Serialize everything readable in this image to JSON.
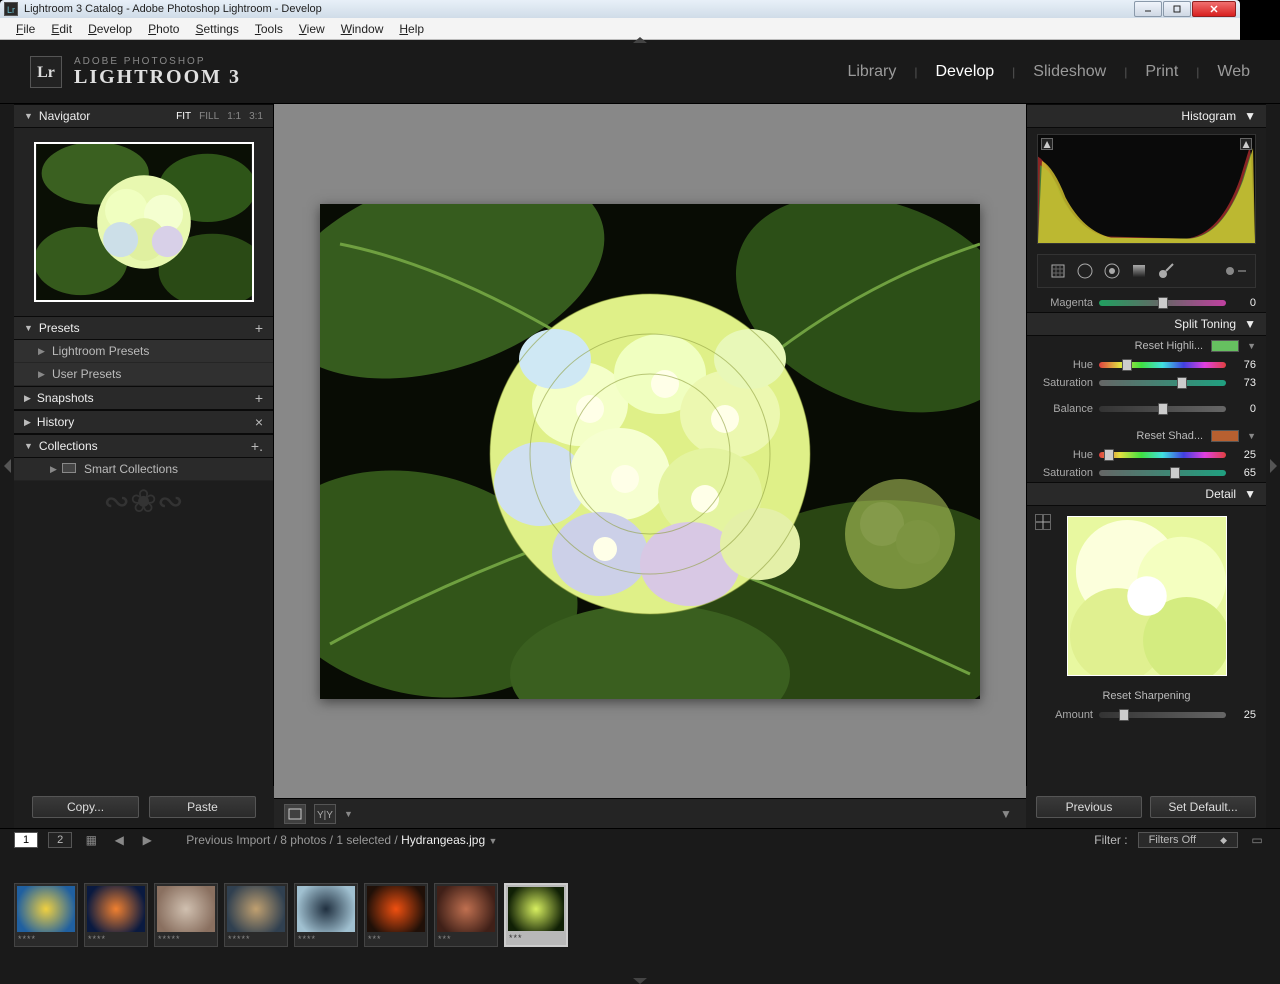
{
  "window": {
    "title": "Lightroom 3 Catalog - Adobe Photoshop Lightroom - Develop",
    "logo_initials": "Lr"
  },
  "menu": [
    "File",
    "Edit",
    "Develop",
    "Photo",
    "Settings",
    "Tools",
    "View",
    "Window",
    "Help"
  ],
  "identity": {
    "line1": "ADOBE PHOTOSHOP",
    "line2": "LIGHTROOM 3",
    "mark": "Lr"
  },
  "modules": [
    "Library",
    "Develop",
    "Slideshow",
    "Print",
    "Web"
  ],
  "module_active": "Develop",
  "left": {
    "navigator": {
      "title": "Navigator",
      "zoom": [
        "FIT",
        "FILL",
        "1:1",
        "3:1"
      ],
      "zoom_active": "FIT"
    },
    "presets": {
      "title": "Presets",
      "items": [
        "Lightroom Presets",
        "User Presets"
      ]
    },
    "snapshots": {
      "title": "Snapshots"
    },
    "history": {
      "title": "History"
    },
    "collections": {
      "title": "Collections",
      "items": [
        "Smart Collections"
      ]
    },
    "copy": "Copy...",
    "paste": "Paste"
  },
  "right": {
    "histogram": {
      "title": "Histogram"
    },
    "magenta": {
      "label": "Magenta",
      "value": 0,
      "pos": 50
    },
    "split_toning": {
      "title": "Split Toning",
      "highlights": {
        "reset": "Reset Highli...",
        "swatch": "#66c060",
        "hue": {
          "label": "Hue",
          "value": 76,
          "pos": 22
        },
        "sat": {
          "label": "Saturation",
          "value": 73,
          "pos": 65
        }
      },
      "balance": {
        "label": "Balance",
        "value": 0,
        "pos": 50
      },
      "shadows": {
        "reset": "Reset Shad...",
        "swatch": "#b86030",
        "hue": {
          "label": "Hue",
          "value": 25,
          "pos": 8
        },
        "sat": {
          "label": "Saturation",
          "value": 65,
          "pos": 60
        }
      }
    },
    "detail": {
      "title": "Detail",
      "sharpening": {
        "reset": "Reset Sharpening",
        "amount": {
          "label": "Amount",
          "value": 25,
          "pos": 20
        }
      }
    },
    "previous": "Previous",
    "setdefault": "Set Default..."
  },
  "filmstrip": {
    "pages": [
      "1",
      "2"
    ],
    "page_active": "1",
    "breadcrumb": {
      "a": "Previous Import",
      "b": "8 photos",
      "c": "1 selected",
      "d": "Hydrangeas.jpg"
    },
    "filter_label": "Filter :",
    "filter_value": "Filters Off",
    "thumbs": [
      {
        "rating": "****",
        "c1": "#2060a0",
        "c2": "#f0d040"
      },
      {
        "rating": "****",
        "c1": "#0a1a40",
        "c2": "#f08030"
      },
      {
        "rating": "*****",
        "c1": "#8a7060",
        "c2": "#d0c0b0"
      },
      {
        "rating": "*****",
        "c1": "#304050",
        "c2": "#c0a070"
      },
      {
        "rating": "****",
        "c1": "#a0c0d0",
        "c2": "#203040"
      },
      {
        "rating": "***",
        "c1": "#201008",
        "c2": "#f05010"
      },
      {
        "rating": "***",
        "c1": "#402018",
        "c2": "#c07050"
      },
      {
        "rating": "***",
        "c1": "#102005",
        "c2": "#d8f060",
        "sel": true
      }
    ]
  }
}
